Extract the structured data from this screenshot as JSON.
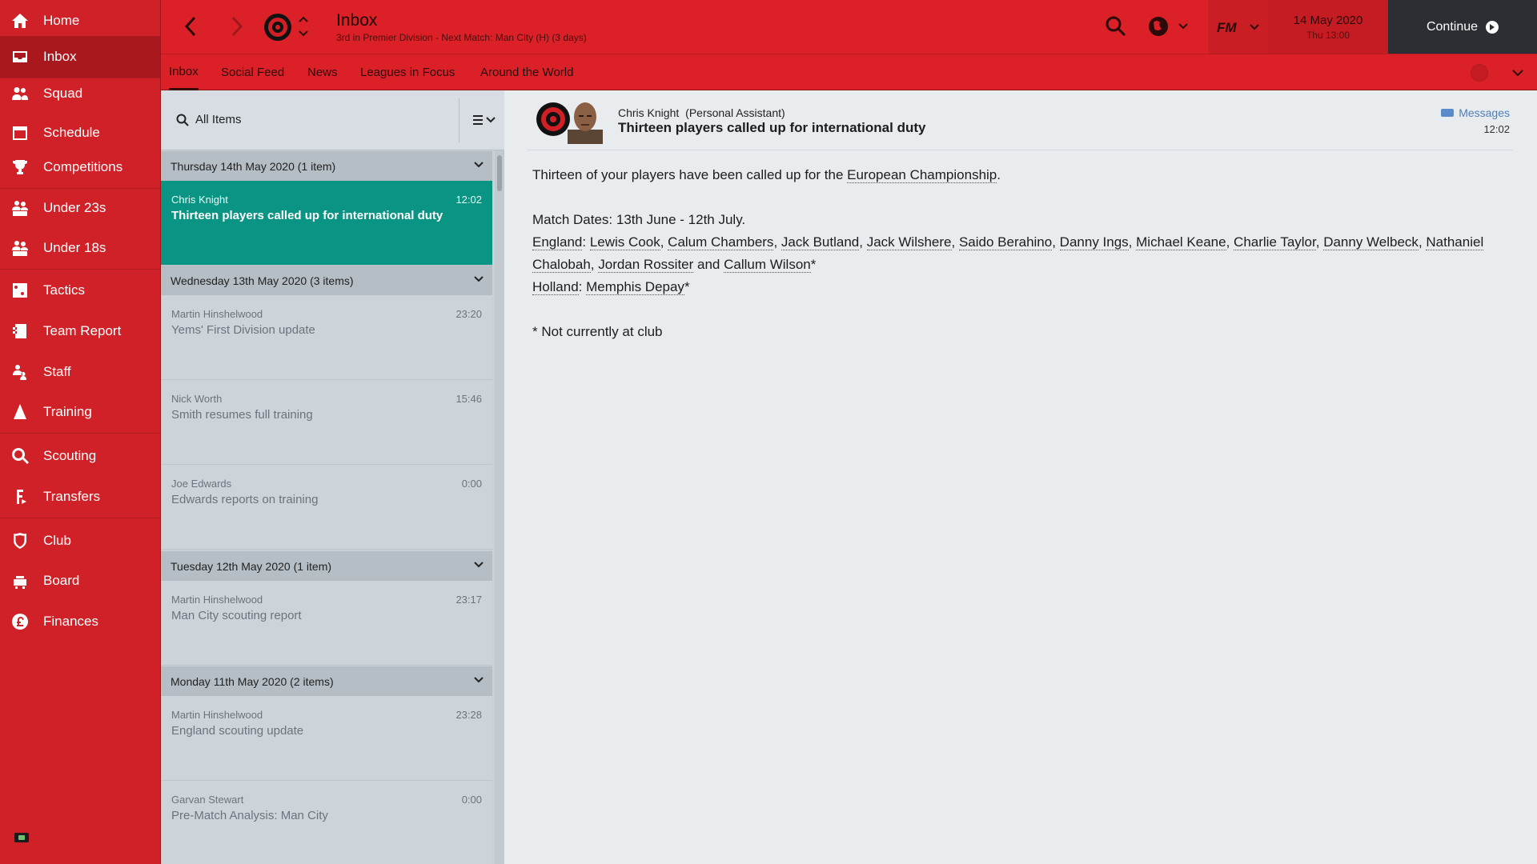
{
  "sidebar": {
    "items": [
      {
        "label": "Home",
        "icon": "home-icon"
      },
      {
        "label": "Inbox",
        "icon": "inbox-icon"
      },
      {
        "label": "Squad",
        "icon": "squad-icon"
      },
      {
        "label": "Schedule",
        "icon": "calendar-icon"
      },
      {
        "label": "Competitions",
        "icon": "trophy-icon"
      },
      {
        "label": "Under 23s",
        "icon": "under23-icon"
      },
      {
        "label": "Under 18s",
        "icon": "under18-icon"
      },
      {
        "label": "Tactics",
        "icon": "tactics-icon"
      },
      {
        "label": "Team Report",
        "icon": "report-icon"
      },
      {
        "label": "Staff",
        "icon": "staff-icon"
      },
      {
        "label": "Training",
        "icon": "training-icon"
      },
      {
        "label": "Scouting",
        "icon": "search-icon"
      },
      {
        "label": "Transfers",
        "icon": "transfers-icon"
      },
      {
        "label": "Club",
        "icon": "club-shield-icon"
      },
      {
        "label": "Board",
        "icon": "board-icon"
      },
      {
        "label": "Finances",
        "icon": "pound-icon"
      }
    ]
  },
  "header": {
    "title": "Inbox",
    "subtitle": "3rd in Premier Division - Next Match: Man City (H) (3 days)",
    "date": "14 May 2020",
    "time": "Thu 13:00",
    "continue_label": "Continue"
  },
  "tabs": [
    {
      "label": "Inbox"
    },
    {
      "label": "Social Feed"
    },
    {
      "label": "News"
    },
    {
      "label": "Leagues in Focus"
    },
    {
      "label": "Around the World"
    }
  ],
  "list": {
    "filter_label": "All Items",
    "groups": [
      {
        "header": "Thursday 14th May 2020 (1 item)",
        "items": [
          {
            "from": "Chris Knight",
            "time": "12:02",
            "subject": "Thirteen players called up for international duty"
          }
        ]
      },
      {
        "header": "Wednesday 13th May 2020 (3 items)",
        "items": [
          {
            "from": "Martin Hinshelwood",
            "time": "23:20",
            "subject": "Yems' First Division update"
          },
          {
            "from": "Nick Worth",
            "time": "15:46",
            "subject": "Smith resumes full training"
          },
          {
            "from": "Joe Edwards",
            "time": "0:00",
            "subject": "Edwards reports on training"
          }
        ]
      },
      {
        "header": "Tuesday 12th May 2020 (1 item)",
        "items": [
          {
            "from": "Martin Hinshelwood",
            "time": "23:17",
            "subject": "Man City scouting report"
          }
        ]
      },
      {
        "header": "Monday 11th May 2020 (2 items)",
        "items": [
          {
            "from": "Martin Hinshelwood",
            "time": "23:28",
            "subject": "England scouting update"
          },
          {
            "from": "Garvan Stewart",
            "time": "0:00",
            "subject": "Pre-Match Analysis: Man City"
          }
        ]
      }
    ]
  },
  "message": {
    "sender": "Chris Knight",
    "sender_role": "(Personal Assistant)",
    "title": "Thirteen players called up for international duty",
    "category": "Messages",
    "time": "12:02",
    "intro_pre": "Thirteen of your players have been called up for the ",
    "intro_link": "European Championship",
    "intro_post": ".",
    "dates": "Match Dates: 13th June - 12th July.",
    "england_label": "England",
    "england_players": [
      "Lewis Cook",
      "Calum Chambers",
      "Jack Butland",
      "Jack Wilshere",
      "Saido Berahino",
      "Danny Ings",
      "Michael Keane",
      "Charlie Taylor",
      "Danny Welbeck",
      "Nathaniel Chalobah",
      "Jordan Rossiter",
      "Callum Wilson"
    ],
    "and_word": " and ",
    "holland_label": "Holland",
    "holland_players": [
      "Memphis Depay"
    ],
    "footnote": "* Not currently at club"
  }
}
